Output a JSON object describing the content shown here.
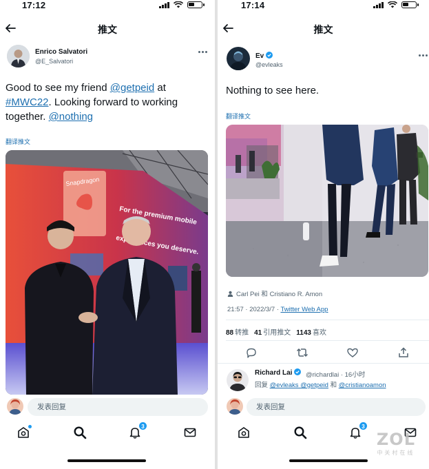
{
  "left": {
    "status_time": "17:12",
    "header_title": "推文",
    "author": {
      "name": "Enrico Salvatori",
      "handle": "@E_Salvatori"
    },
    "tweet": {
      "line1_text": "Good to see my friend ",
      "line1_link": "@getpeid",
      "line1_end": " at",
      "line2_link": "#MWC22",
      "line2_text": ". Looking forward to working",
      "line3_text": "together. ",
      "line3_link": "@nothing"
    },
    "translate": "翻译推文",
    "photo_texts": {
      "brand": "Snapdragon",
      "line1": "For the premium mobile",
      "line2": "experiences you deserve."
    },
    "compose_placeholder": "发表回复",
    "nav": {
      "notifications_badge": "3"
    }
  },
  "right": {
    "status_time": "17:14",
    "header_title": "推文",
    "author": {
      "name": "Ev",
      "handle": "@evleaks",
      "verified": true
    },
    "tweet_text": "Nothing to see here.",
    "translate": "翻译推文",
    "tagged": "Carl Pei 和 Cristiano R. Amon",
    "timestamp": "21:57 · 2022/3/7 · ",
    "source": "Twitter Web App",
    "stats": [
      {
        "count": "88",
        "label": "转推"
      },
      {
        "count": "41",
        "label": "引用推文"
      },
      {
        "count": "1143",
        "label": "喜欢"
      }
    ],
    "reply": {
      "name": "Richard Lai",
      "handle": "@richardlai · 16小时",
      "reply_prefix": "回复 ",
      "reply_to_1": "@evleaks @getpeid",
      "reply_joiner": " 和 ",
      "reply_to_2": "@cristianoamon"
    },
    "compose_placeholder": "发表回复",
    "nav": {
      "notifications_badge": "3"
    }
  },
  "watermark": {
    "logo": "ZOL",
    "sub": "中关村在线"
  },
  "colors": {
    "link": "#1d6fb0",
    "badge": "#1d9bf0",
    "verified": "#1d9bf0"
  }
}
